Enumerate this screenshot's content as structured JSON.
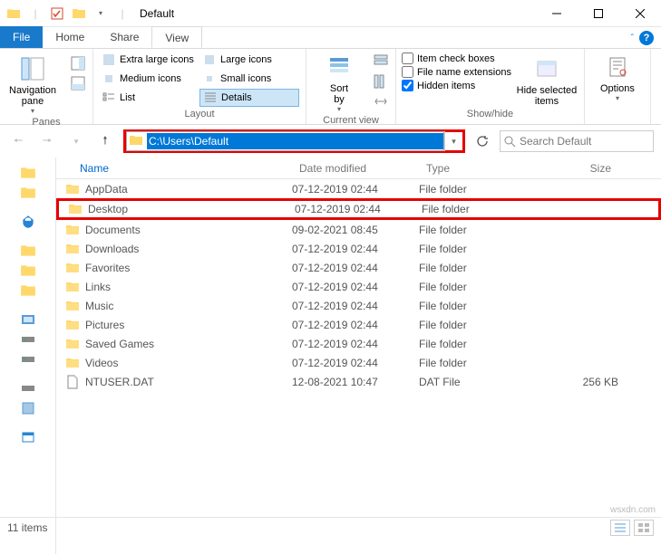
{
  "title": "Default",
  "tabs": {
    "file": "File",
    "home": "Home",
    "share": "Share",
    "view": "View"
  },
  "ribbon": {
    "panes": {
      "navigation": "Navigation\npane",
      "label": "Panes"
    },
    "layout": {
      "items": [
        "Extra large icons",
        "Large icons",
        "Medium icons",
        "Small icons",
        "List",
        "Details"
      ],
      "label": "Layout"
    },
    "sortby": "Sort\nby",
    "curview_label": "Current view",
    "checks": {
      "boxes": "Item check boxes",
      "ext": "File name extensions",
      "hidden": "Hidden items"
    },
    "hidesel": "Hide selected\nitems",
    "showhide_label": "Show/hide",
    "options": "Options"
  },
  "address": "C:\\Users\\Default",
  "search_placeholder": "Search Default",
  "columns": {
    "name": "Name",
    "date": "Date modified",
    "type": "Type",
    "size": "Size"
  },
  "files": [
    {
      "name": "AppData",
      "date": "07-12-2019 02:44",
      "type": "File folder",
      "kind": "folder"
    },
    {
      "name": "Desktop",
      "date": "07-12-2019 02:44",
      "type": "File folder",
      "kind": "folder",
      "hl": true
    },
    {
      "name": "Documents",
      "date": "09-02-2021 08:45",
      "type": "File folder",
      "kind": "folder"
    },
    {
      "name": "Downloads",
      "date": "07-12-2019 02:44",
      "type": "File folder",
      "kind": "folder"
    },
    {
      "name": "Favorites",
      "date": "07-12-2019 02:44",
      "type": "File folder",
      "kind": "folder"
    },
    {
      "name": "Links",
      "date": "07-12-2019 02:44",
      "type": "File folder",
      "kind": "folder"
    },
    {
      "name": "Music",
      "date": "07-12-2019 02:44",
      "type": "File folder",
      "kind": "folder"
    },
    {
      "name": "Pictures",
      "date": "07-12-2019 02:44",
      "type": "File folder",
      "kind": "folder"
    },
    {
      "name": "Saved Games",
      "date": "07-12-2019 02:44",
      "type": "File folder",
      "kind": "folder"
    },
    {
      "name": "Videos",
      "date": "07-12-2019 02:44",
      "type": "File folder",
      "kind": "folder"
    },
    {
      "name": "NTUSER.DAT",
      "date": "12-08-2021 10:47",
      "type": "DAT File",
      "size": "256 KB",
      "kind": "file"
    }
  ],
  "status": "11 items",
  "watermark": "wsxdn.com"
}
